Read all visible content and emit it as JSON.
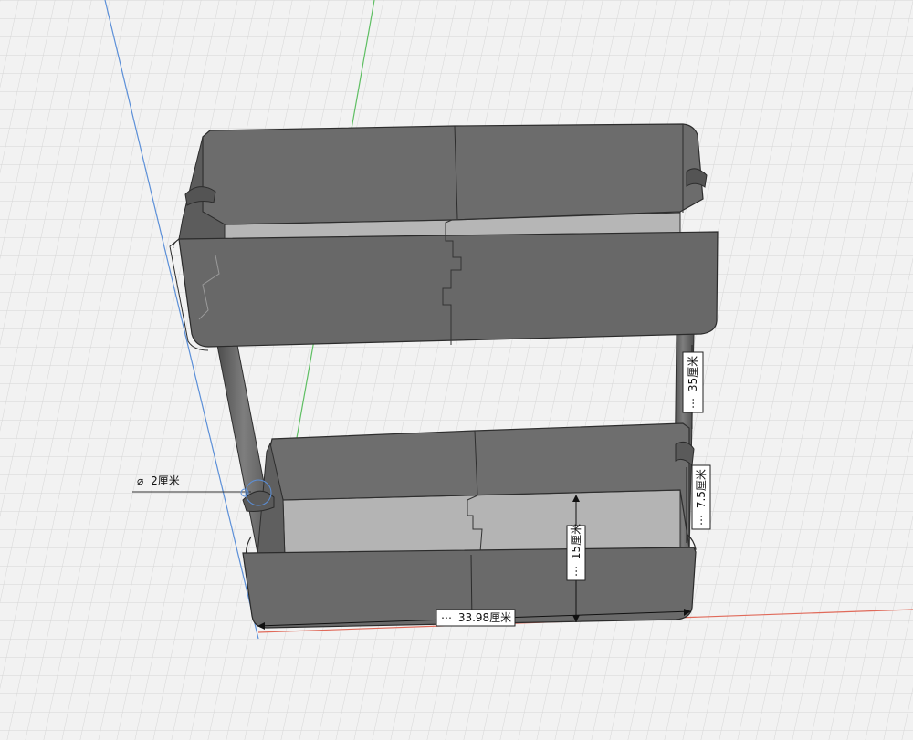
{
  "dimensions": {
    "diameter": {
      "symbol": "⌀",
      "value": "2厘米"
    },
    "total_height": {
      "prefix": "⋯",
      "value": "35厘米"
    },
    "leg_gap": {
      "prefix": "⋯",
      "value": "7.5厘米"
    },
    "tray_depth": {
      "prefix": "⋯",
      "value": "15厘米"
    },
    "width": {
      "prefix": "⋯",
      "value": "33.98厘米"
    }
  },
  "colors": {
    "grid_bg": "#f2f2f2",
    "grid_minor": "#d6d6d6",
    "grid_major": "#c4c4c4",
    "axis_x": "#e06a5a",
    "axis_y": "#5fbf63",
    "axis_z": "#5b8fd8",
    "body": "#6b6b6b",
    "body_dark": "#575757",
    "body_light": "#a3a3a3",
    "floor": "#b6b6b6"
  }
}
